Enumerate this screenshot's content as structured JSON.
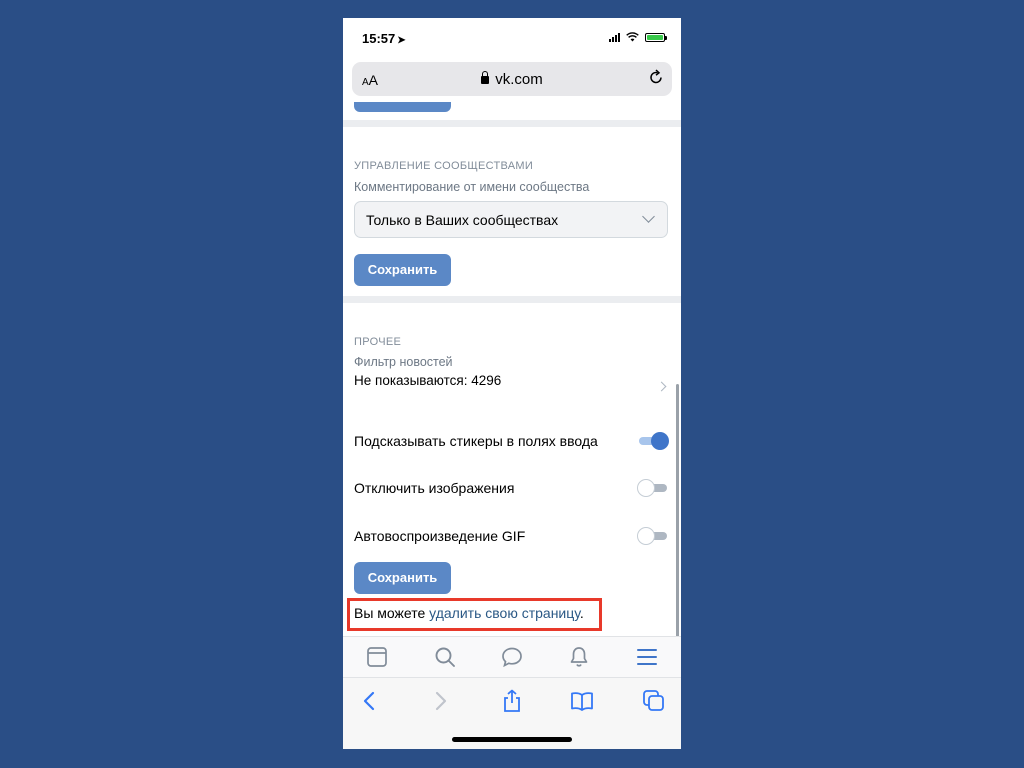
{
  "status_bar": {
    "time": "15:57"
  },
  "url_bar": {
    "text_size_label_small": "A",
    "text_size_label_large": "A",
    "domain": "vk.com"
  },
  "communities_section": {
    "title": "УПРАВЛЕНИЕ СООБЩЕСТВАМИ",
    "comment_label": "Комментирование от имени сообщества",
    "comment_select_value": "Только в Ваших сообществах",
    "save_label": "Сохранить"
  },
  "other_section": {
    "title": "ПРОЧЕЕ",
    "news_filter_label": "Фильтр новостей",
    "news_filter_value": "Не показываются: 4296",
    "sticker_hints_label": "Подсказывать стикеры в полях ввода",
    "sticker_hints_on": true,
    "disable_images_label": "Отключить изображения",
    "disable_images_on": false,
    "autoplay_gif_label": "Автовоспроизведение GIF",
    "autoplay_gif_on": false,
    "save_label": "Сохранить"
  },
  "delete_page": {
    "prefix": "Вы можете ",
    "link_text": "удалить свою страницу",
    "suffix": "."
  },
  "vk_tabbar": {
    "items": [
      "news-icon",
      "search-icon",
      "messages-icon",
      "notifications-icon",
      "menu-icon"
    ]
  },
  "safari_toolbar": {
    "items": [
      "back-icon",
      "forward-icon",
      "share-icon",
      "bookmarks-icon",
      "tabs-icon"
    ]
  },
  "colors": {
    "background": "#2a4e86",
    "accent": "#5b88c6",
    "link": "#2a5885",
    "highlight": "#e8392a"
  }
}
